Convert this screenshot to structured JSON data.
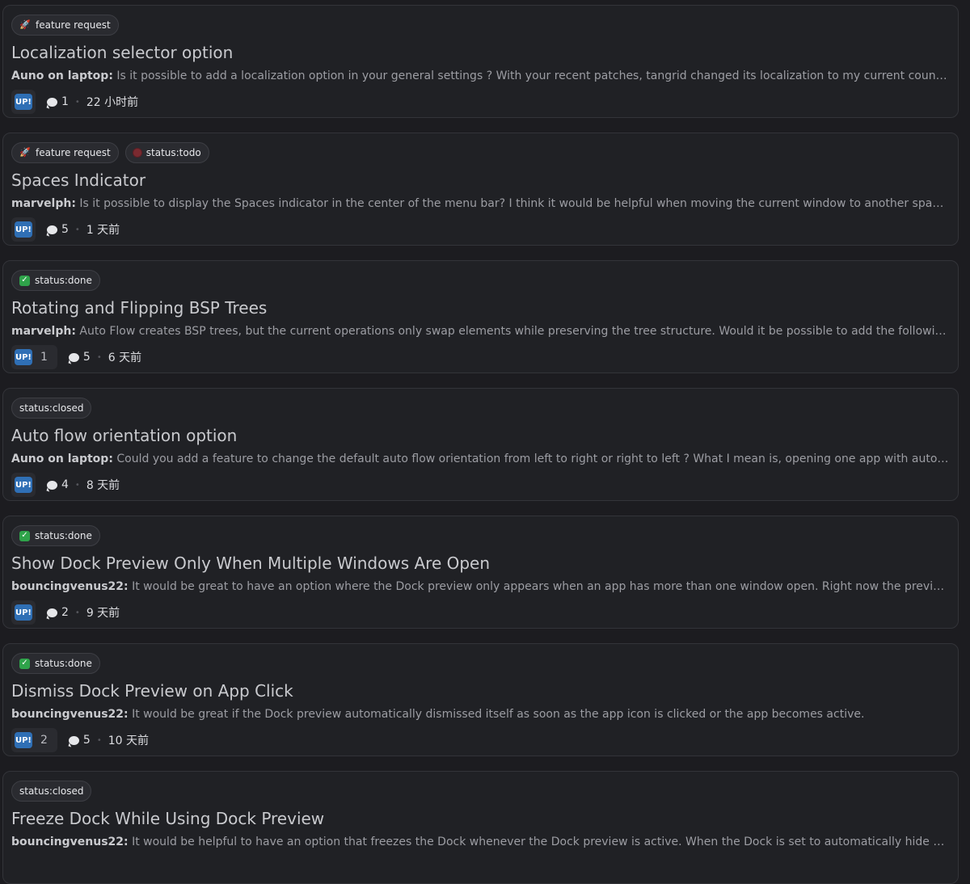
{
  "posts": [
    {
      "tags": [
        {
          "icon": "rocket-icon",
          "glyph": "🚀",
          "label": "feature request"
        }
      ],
      "title": "Localization selector option",
      "author": "Auno on laptop:",
      "excerpt": " Is it possible to add a localization option in your general settings ? With your recent patches, tangrid changed its localization to my current country but that is not my ...",
      "upvote_badge": "UP!",
      "upvotes": "",
      "comments": "1",
      "time": "22 小时前"
    },
    {
      "tags": [
        {
          "icon": "rocket-icon",
          "glyph": "🚀",
          "label": "feature request"
        },
        {
          "icon": "todo-icon",
          "glyph": "",
          "label": "status:todo"
        }
      ],
      "title": "Spaces Indicator",
      "author": "marvelph:",
      "excerpt": " Is it possible to display the Spaces indicator in the center of the menu bar? I think it would be helpful when moving the current window to another space.",
      "upvote_badge": "UP!",
      "upvotes": "",
      "comments": "5",
      "time": "1 天前"
    },
    {
      "tags": [
        {
          "icon": "checkmark-icon",
          "glyph": "✓",
          "label": "status:done"
        }
      ],
      "title": "Rotating and Flipping BSP Trees",
      "author": "marvelph:",
      "excerpt": " Auto Flow creates BSP trees, but the current operations only swap elements while preserving the tree structure. Would it be possible to add the following transformations ...",
      "upvote_badge": "UP!",
      "upvotes": "1",
      "comments": "5",
      "time": "6 天前"
    },
    {
      "tags": [
        {
          "icon": "",
          "glyph": "",
          "label": "status:closed"
        }
      ],
      "title": "Auto flow orientation option",
      "author": "Auno on laptop:",
      "excerpt": " Could you add a feature to change the default auto flow orientation from left to right or right to left ? What I mean is, opening one app with auto flow will put in in full ...",
      "upvote_badge": "UP!",
      "upvotes": "",
      "comments": "4",
      "time": "8 天前"
    },
    {
      "tags": [
        {
          "icon": "checkmark-icon",
          "glyph": "✓",
          "label": "status:done"
        }
      ],
      "title": "Show Dock Preview Only When Multiple Windows Are Open",
      "author": "bouncingvenus22:",
      "excerpt": " It would be great to have an option where the Dock preview only appears when an app has more than one window open. Right now the preview shows even for singl...",
      "upvote_badge": "UP!",
      "upvotes": "",
      "comments": "2",
      "time": "9 天前"
    },
    {
      "tags": [
        {
          "icon": "checkmark-icon",
          "glyph": "✓",
          "label": "status:done"
        }
      ],
      "title": "Dismiss Dock Preview on App Click",
      "author": "bouncingvenus22:",
      "excerpt": " It would be great if the Dock preview automatically dismissed itself as soon as the app icon is clicked or the app becomes active.",
      "upvote_badge": "UP!",
      "upvotes": "2",
      "comments": "5",
      "time": "10 天前"
    },
    {
      "tags": [
        {
          "icon": "",
          "glyph": "",
          "label": "status:closed"
        }
      ],
      "title": "Freeze Dock While Using Dock Preview",
      "author": "bouncingvenus22:",
      "excerpt": " It would be helpful to have an option that freezes the Dock whenever the Dock preview is active. When the Dock is set to automatically hide and show, it disappear...",
      "upvote_badge": "",
      "upvotes": "",
      "comments": "",
      "time": ""
    }
  ]
}
